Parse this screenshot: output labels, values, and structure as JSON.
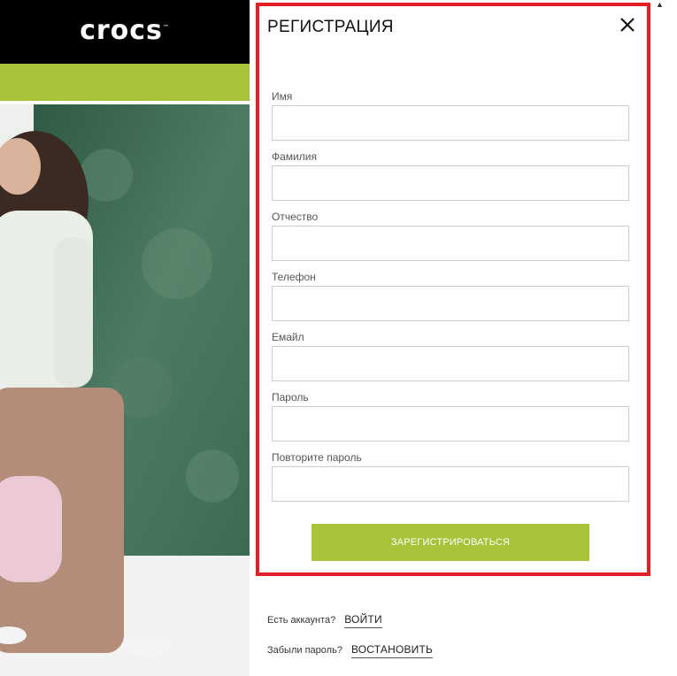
{
  "site": {
    "logo_text": "crocs",
    "logo_tm": "™",
    "brand_color": "#a8c23a",
    "highlight_color": "#e41e26"
  },
  "modal": {
    "title": "РЕГИСТРАЦИЯ",
    "close_icon": "close-icon",
    "fields": [
      {
        "label": "Имя",
        "value": "",
        "placeholder": ""
      },
      {
        "label": "Фамилия",
        "value": "",
        "placeholder": ""
      },
      {
        "label": "Отчество",
        "value": "",
        "placeholder": ""
      },
      {
        "label": "Телефон",
        "value": "",
        "placeholder": ""
      },
      {
        "label": "Емайл",
        "value": "",
        "placeholder": ""
      },
      {
        "label": "Пароль",
        "value": "",
        "placeholder": ""
      },
      {
        "label": "Повторите пароль",
        "value": "",
        "placeholder": ""
      }
    ],
    "submit_label": "ЗАРЕГИСТРИРОВАТЬСЯ"
  },
  "footer": {
    "has_account_text": "Есть аккаунта?",
    "login_link": "ВОЙТИ",
    "forgot_text": "Забыли пароль?",
    "restore_link": "ВОСТАНОВИТЬ"
  }
}
